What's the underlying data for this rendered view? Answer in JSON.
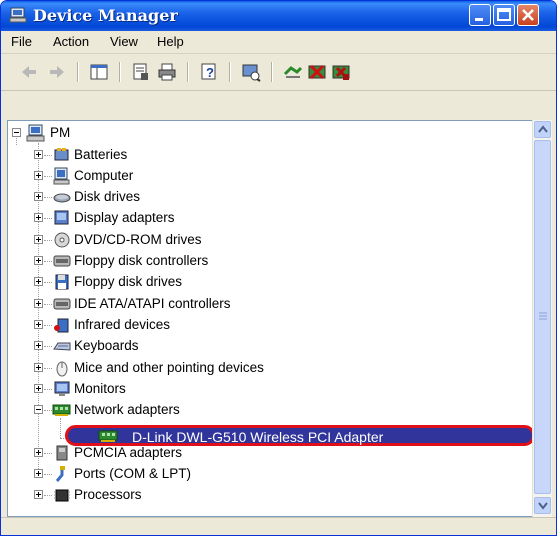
{
  "window": {
    "title": "Device Manager"
  },
  "menu": [
    "File",
    "Action",
    "View",
    "Help"
  ],
  "toolbar_icons": [
    "back-arrow-icon",
    "forward-arrow-icon",
    "show-hide-console-tree-icon",
    "properties-icon",
    "print-icon",
    "help-icon",
    "scan-hardware-icon",
    "update-driver-icon",
    "disable-device-icon",
    "uninstall-device-icon"
  ],
  "tree": {
    "root": "PM",
    "items": [
      {
        "label": "Batteries",
        "icon": "battery-icon"
      },
      {
        "label": "Computer",
        "icon": "computer-icon"
      },
      {
        "label": "Disk drives",
        "icon": "disk-drive-icon"
      },
      {
        "label": "Display adapters",
        "icon": "display-adapter-icon"
      },
      {
        "label": "DVD/CD-ROM drives",
        "icon": "cdrom-icon"
      },
      {
        "label": "Floppy disk controllers",
        "icon": "controller-icon"
      },
      {
        "label": "Floppy disk drives",
        "icon": "floppy-icon"
      },
      {
        "label": "IDE ATA/ATAPI controllers",
        "icon": "controller-icon"
      },
      {
        "label": "Infrared devices",
        "icon": "infrared-icon"
      },
      {
        "label": "Keyboards",
        "icon": "keyboard-icon"
      },
      {
        "label": "Mice and other pointing devices",
        "icon": "mouse-icon"
      },
      {
        "label": "Monitors",
        "icon": "monitor-icon"
      },
      {
        "label": "Network adapters",
        "icon": "network-card-icon",
        "expanded": true
      }
    ],
    "selected_child": "D-Link DWL-G510 Wireless PCI Adapter",
    "items_after": [
      {
        "label": "PCMCIA adapters",
        "icon": "pcmcia-icon"
      },
      {
        "label": "Ports (COM & LPT)",
        "icon": "port-icon"
      },
      {
        "label": "Processors",
        "icon": "processor-icon"
      }
    ]
  },
  "colors": {
    "title_bar": "#0a5fe5",
    "selection": "#31359b",
    "highlight_border": "#e0101a"
  }
}
